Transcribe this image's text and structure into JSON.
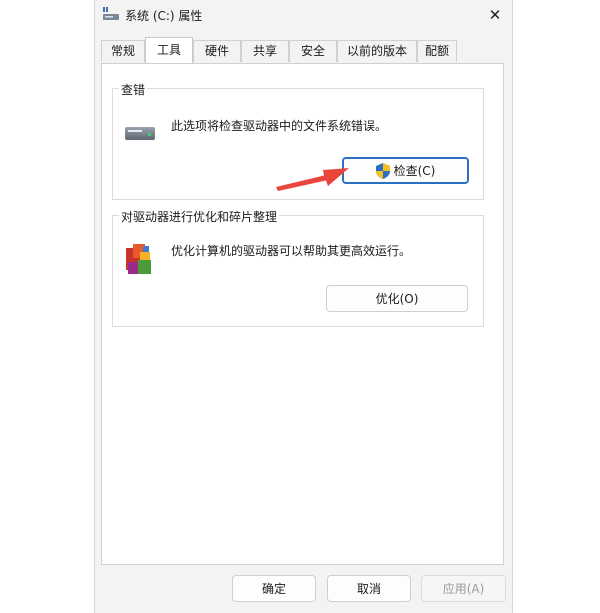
{
  "window": {
    "title": "系统 (C:) 属性",
    "close_glyph": "✕"
  },
  "tabs": [
    {
      "label": "常规",
      "active": false
    },
    {
      "label": "工具",
      "active": true
    },
    {
      "label": "硬件",
      "active": false
    },
    {
      "label": "共享",
      "active": false
    },
    {
      "label": "安全",
      "active": false
    },
    {
      "label": "以前的版本",
      "active": false
    },
    {
      "label": "配额",
      "active": false
    }
  ],
  "error_check": {
    "title": "查错",
    "description": "此选项将检查驱动器中的文件系统错误。",
    "button_label": "检查(C)",
    "icon": "drive-icon",
    "button_icon": "shield-icon"
  },
  "optimize": {
    "title": "对驱动器进行优化和碎片整理",
    "description": "优化计算机的驱动器可以帮助其更高效运行。",
    "button_label": "优化(O)",
    "icon": "defrag-icon"
  },
  "footer": {
    "ok_label": "确定",
    "cancel_label": "取消",
    "apply_label": "应用(A)"
  },
  "colors": {
    "annotation_arrow": "#e8453c",
    "primary_border": "#2b6fc4",
    "dialog_bg": "#f3f3f3"
  }
}
